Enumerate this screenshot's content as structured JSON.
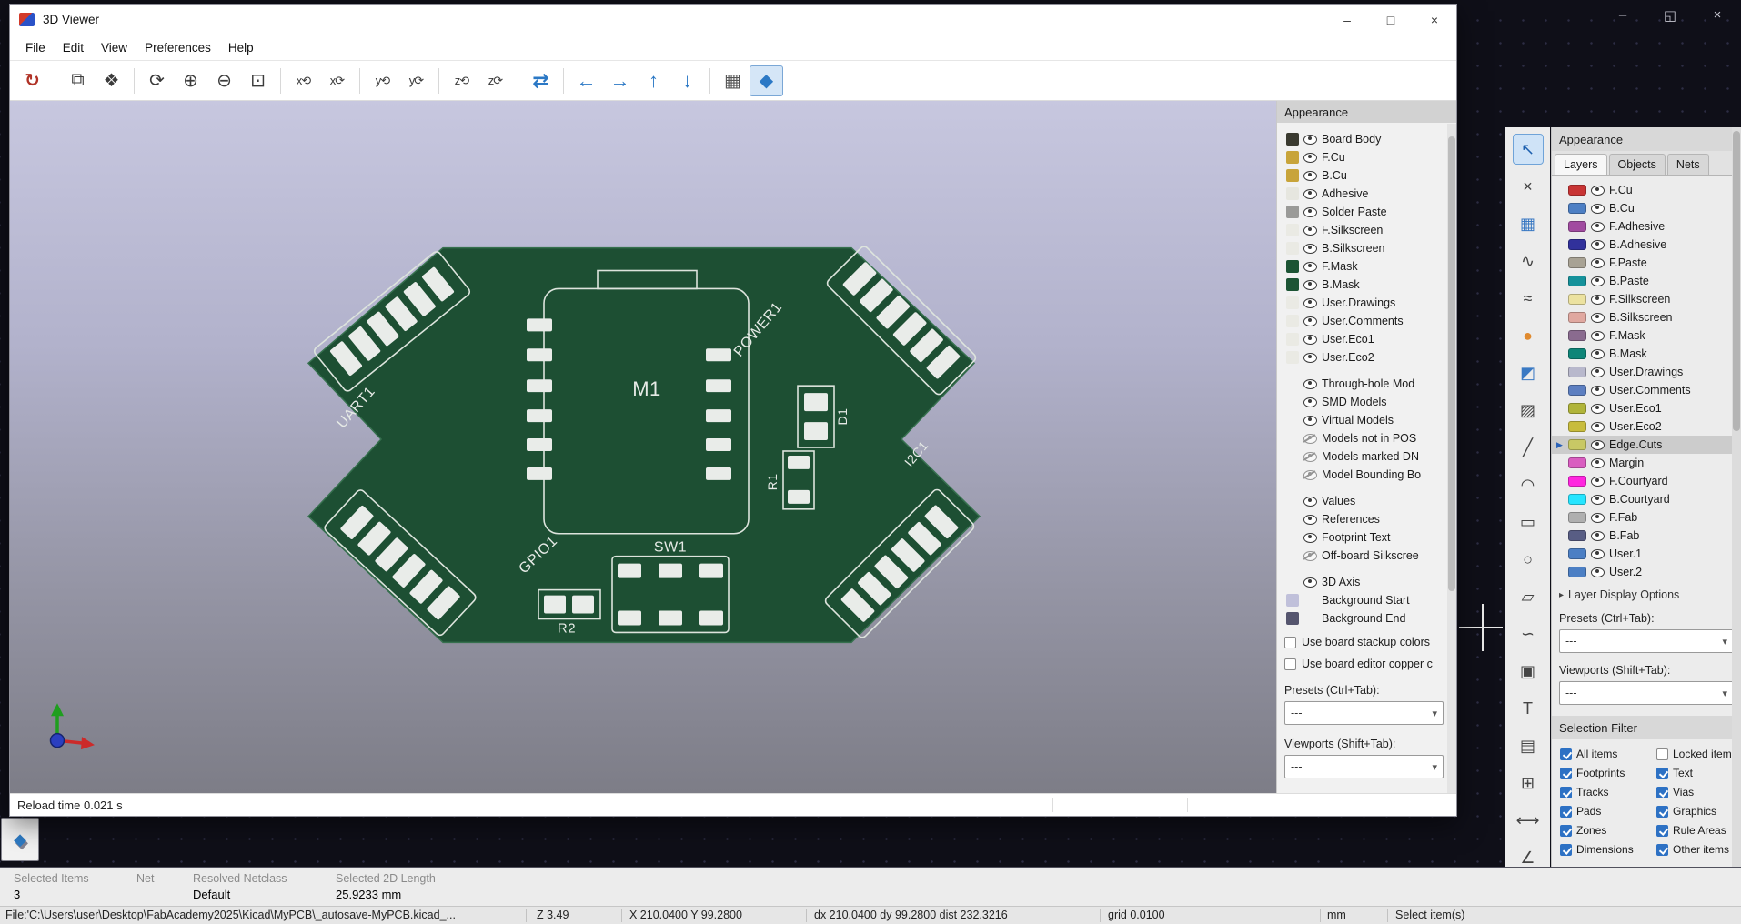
{
  "icons": {
    "dropdown_chevron": "▾",
    "collapse_arrow": "▸"
  },
  "viewer": {
    "title": "3D Viewer",
    "controls": [
      {
        "name": "minimize-button",
        "glyph": "–"
      },
      {
        "name": "maximize-button",
        "glyph": "□"
      },
      {
        "name": "close-button",
        "glyph": "×"
      }
    ],
    "menus": [
      {
        "name": "menu-file",
        "label": "File"
      },
      {
        "name": "menu-edit",
        "label": "Edit"
      },
      {
        "name": "menu-view",
        "label": "View"
      },
      {
        "name": "menu-preferences",
        "label": "Preferences"
      },
      {
        "name": "menu-help",
        "label": "Help"
      }
    ],
    "toolbar": [
      {
        "name": "reload-board-icon",
        "glyph": "↻",
        "cls": "red",
        "ia": "true"
      },
      {
        "name": "toolbar-separator",
        "glyph": "",
        "cls": "sep",
        "ia": "false"
      },
      {
        "name": "copy-image-icon",
        "glyph": "⧉",
        "cls": "",
        "ia": "true"
      },
      {
        "name": "render-raytracing-icon",
        "glyph": "❖",
        "cls": "",
        "ia": "true"
      },
      {
        "name": "toolbar-separator",
        "glyph": "",
        "cls": "sep",
        "ia": "false"
      },
      {
        "name": "redraw-icon",
        "glyph": "⟳",
        "cls": "",
        "ia": "true"
      },
      {
        "name": "zoom-in-icon",
        "glyph": "⊕",
        "cls": "",
        "ia": "true"
      },
      {
        "name": "zoom-out-icon",
        "glyph": "⊖",
        "cls": "",
        "ia": "true"
      },
      {
        "name": "zoom-fit-icon",
        "glyph": "⊡",
        "cls": "",
        "ia": "true"
      },
      {
        "name": "toolbar-separator",
        "glyph": "",
        "cls": "sep",
        "ia": "false"
      },
      {
        "name": "rotate-x-cw-icon",
        "glyph": "x⟲",
        "cls": "axis",
        "ia": "true"
      },
      {
        "name": "rotate-x-ccw-icon",
        "glyph": "x⟳",
        "cls": "axis",
        "ia": "true"
      },
      {
        "name": "toolbar-separator",
        "glyph": "",
        "cls": "sep",
        "ia": "false"
      },
      {
        "name": "rotate-y-cw-icon",
        "glyph": "y⟲",
        "cls": "axis",
        "ia": "true"
      },
      {
        "name": "rotate-y-ccw-icon",
        "glyph": "y⟳",
        "cls": "axis",
        "ia": "true"
      },
      {
        "name": "toolbar-separator",
        "glyph": "",
        "cls": "sep",
        "ia": "false"
      },
      {
        "name": "rotate-z-cw-icon",
        "glyph": "z⟲",
        "cls": "axis",
        "ia": "true"
      },
      {
        "name": "rotate-z-ccw-icon",
        "glyph": "z⟳",
        "cls": "axis",
        "ia": "true"
      },
      {
        "name": "toolbar-separator",
        "glyph": "",
        "cls": "sep",
        "ia": "false"
      },
      {
        "name": "flip-board-icon",
        "glyph": "⇄",
        "cls": "blue",
        "ia": "true"
      },
      {
        "name": "toolbar-separator",
        "glyph": "",
        "cls": "sep",
        "ia": "false"
      },
      {
        "name": "move-left-icon",
        "glyph": "←",
        "cls": "blue",
        "ia": "true"
      },
      {
        "name": "move-right-icon",
        "glyph": "→",
        "cls": "blue",
        "ia": "true"
      },
      {
        "name": "move-up-icon",
        "glyph": "↑",
        "cls": "blue",
        "ia": "true"
      },
      {
        "name": "move-down-icon",
        "glyph": "↓",
        "cls": "blue",
        "ia": "true"
      },
      {
        "name": "toolbar-separator",
        "glyph": "",
        "cls": "sep",
        "ia": "false"
      },
      {
        "name": "orthographic-projection-icon",
        "glyph": "▦",
        "cls": "cube",
        "ia": "true"
      },
      {
        "name": "appearance-manager-icon",
        "glyph": "◆",
        "cls": "blue active",
        "ia": "true"
      }
    ],
    "board": {
      "labels": {
        "m1": "M1",
        "power1": "POWER1",
        "uart1": "UART1",
        "gpio1": "GPIO1",
        "sw1": "SW1",
        "r1": "R1",
        "r2": "R2",
        "d1": "D1",
        "i2c1": "I2C1"
      }
    },
    "panel": {
      "header": "Appearance",
      "rows": [
        {
          "label": "Board Body",
          "swatch": "#3a3a30",
          "eye": "open",
          "cls": ""
        },
        {
          "label": "F.Cu",
          "swatch": "#c8a43a",
          "eye": "open",
          "cls": ""
        },
        {
          "label": "B.Cu",
          "swatch": "#c8a43a",
          "eye": "open",
          "cls": ""
        },
        {
          "label": "Adhesive",
          "swatch": "#e6e6df",
          "eye": "open",
          "cls": ""
        },
        {
          "label": "Solder Paste",
          "swatch": "#9a9a98",
          "eye": "open",
          "cls": ""
        },
        {
          "label": "F.Silkscreen",
          "swatch": "#eaeae4",
          "eye": "open",
          "cls": ""
        },
        {
          "label": "B.Silkscreen",
          "swatch": "#eaeae4",
          "eye": "open",
          "cls": ""
        },
        {
          "label": "F.Mask",
          "swatch": "#1c5434",
          "eye": "open",
          "cls": ""
        },
        {
          "label": "B.Mask",
          "swatch": "#1c5434",
          "eye": "open",
          "cls": ""
        },
        {
          "label": "User.Drawings",
          "swatch": "#eaeae4",
          "eye": "open",
          "cls": ""
        },
        {
          "label": "User.Comments",
          "swatch": "#eaeae4",
          "eye": "open",
          "cls": ""
        },
        {
          "label": "User.Eco1",
          "swatch": "#eaeae4",
          "eye": "open",
          "cls": ""
        },
        {
          "label": "User.Eco2",
          "swatch": "#eaeae4",
          "eye": "open",
          "cls": ""
        },
        {
          "label": "Through-hole Mod",
          "swatch": "",
          "eye": "open",
          "cls": "gap"
        },
        {
          "label": "SMD Models",
          "swatch": "",
          "eye": "open",
          "cls": ""
        },
        {
          "label": "Virtual Models",
          "swatch": "",
          "eye": "open",
          "cls": ""
        },
        {
          "label": "Models not in POS",
          "swatch": "",
          "eye": "crossed",
          "cls": ""
        },
        {
          "label": "Models marked DN",
          "swatch": "",
          "eye": "crossed",
          "cls": ""
        },
        {
          "label": "Model Bounding Bo",
          "swatch": "",
          "eye": "crossed",
          "cls": ""
        },
        {
          "label": "Values",
          "swatch": "",
          "eye": "open",
          "cls": "gap"
        },
        {
          "label": "References",
          "swatch": "",
          "eye": "open",
          "cls": ""
        },
        {
          "label": "Footprint Text",
          "swatch": "",
          "eye": "open",
          "cls": ""
        },
        {
          "label": "Off-board Silkscree",
          "swatch": "",
          "eye": "crossed",
          "cls": ""
        },
        {
          "label": "3D Axis",
          "swatch": "",
          "eye": "open",
          "cls": "gap"
        },
        {
          "label": "Background Start",
          "swatch": "#c0c0da",
          "eye": "none",
          "cls": ""
        },
        {
          "label": "Background End",
          "swatch": "#55556e",
          "eye": "none",
          "cls": ""
        }
      ],
      "checkboxes": [
        {
          "label": "Use board stackup colors",
          "state": "unchecked"
        },
        {
          "label": "Use board editor copper c",
          "state": "unchecked"
        }
      ],
      "presets_label": "Presets (Ctrl+Tab):",
      "presets_value": "---",
      "viewports_label": "Viewports (Shift+Tab):",
      "viewports_value": "---"
    },
    "status": "Reload time 0.021 s"
  },
  "editor": {
    "window_controls": [
      {
        "name": "window-minimize-button",
        "glyph": "–"
      },
      {
        "name": "window-restore-button",
        "glyph": "◱"
      },
      {
        "name": "window-close-button",
        "glyph": "×"
      }
    ],
    "right_toolbar": [
      {
        "name": "select-tool-icon",
        "glyph": "↖",
        "cls": "active"
      },
      {
        "name": "highlight-net-icon",
        "glyph": "×",
        "cls": ""
      },
      {
        "name": "local-ratsnest-icon",
        "glyph": "▦",
        "cls": "blue"
      },
      {
        "name": "route-tracks-icon",
        "glyph": "∿",
        "cls": ""
      },
      {
        "name": "tune-length-icon",
        "glyph": "≈",
        "cls": ""
      },
      {
        "name": "add-via-icon",
        "glyph": "●",
        "cls": "orange"
      },
      {
        "name": "draw-zone-icon",
        "glyph": "◩",
        "cls": "blue"
      },
      {
        "name": "rule-area-icon",
        "glyph": "▨",
        "cls": ""
      },
      {
        "name": "draw-line-icon",
        "glyph": "╱",
        "cls": ""
      },
      {
        "name": "draw-arc-icon",
        "glyph": "◠",
        "cls": ""
      },
      {
        "name": "draw-rectangle-icon",
        "glyph": "▭",
        "cls": ""
      },
      {
        "name": "draw-circle-icon",
        "glyph": "○",
        "cls": ""
      },
      {
        "name": "draw-polygon-icon",
        "glyph": "▱",
        "cls": ""
      },
      {
        "name": "draw-bezier-icon",
        "glyph": "∽",
        "cls": ""
      },
      {
        "name": "add-image-icon",
        "glyph": "▣",
        "cls": ""
      },
      {
        "name": "add-text-icon",
        "glyph": "T",
        "cls": ""
      },
      {
        "name": "add-textbox-icon",
        "glyph": "▤",
        "cls": ""
      },
      {
        "name": "add-table-icon",
        "glyph": "⊞",
        "cls": ""
      },
      {
        "name": "add-dimension-icon",
        "glyph": "⟷",
        "cls": ""
      },
      {
        "name": "measure-tool-icon",
        "glyph": "∠",
        "cls": ""
      }
    ],
    "appearance": {
      "header": "Appearance",
      "tabs": [
        {
          "name": "tab-layers",
          "label": "Layers",
          "cls": "active"
        },
        {
          "name": "tab-objects",
          "label": "Objects",
          "cls": ""
        },
        {
          "name": "tab-nets",
          "label": "Nets",
          "cls": ""
        }
      ],
      "layers": [
        {
          "label": "F.Cu",
          "color": "#c83434",
          "cls": "",
          "marker": ""
        },
        {
          "label": "B.Cu",
          "color": "#4d7fc4",
          "cls": "",
          "marker": ""
        },
        {
          "label": "F.Adhesive",
          "color": "#a14ba0",
          "cls": "",
          "marker": ""
        },
        {
          "label": "B.Adhesive",
          "color": "#31319b",
          "cls": "",
          "marker": ""
        },
        {
          "label": "F.Paste",
          "color": "#a8a294",
          "cls": "",
          "marker": ""
        },
        {
          "label": "B.Paste",
          "color": "#16929b",
          "cls": "",
          "marker": ""
        },
        {
          "label": "F.Silkscreen",
          "color": "#ece2a0",
          "cls": "",
          "marker": ""
        },
        {
          "label": "B.Silkscreen",
          "color": "#e0a8a0",
          "cls": "",
          "marker": ""
        },
        {
          "label": "F.Mask",
          "color": "#8a6b8f",
          "cls": "",
          "marker": ""
        },
        {
          "label": "B.Mask",
          "color": "#0e8578",
          "cls": "",
          "marker": ""
        },
        {
          "label": "User.Drawings",
          "color": "#b8b8cc",
          "cls": "",
          "marker": ""
        },
        {
          "label": "User.Comments",
          "color": "#5d7fc1",
          "cls": "",
          "marker": ""
        },
        {
          "label": "User.Eco1",
          "color": "#b0b43a",
          "cls": "",
          "marker": ""
        },
        {
          "label": "User.Eco2",
          "color": "#c8bc3c",
          "cls": "",
          "marker": ""
        },
        {
          "label": "Edge.Cuts",
          "color": "#c8c865",
          "cls": "selected",
          "marker": "▶"
        },
        {
          "label": "Margin",
          "color": "#d95dc0",
          "cls": "",
          "marker": ""
        },
        {
          "label": "F.Courtyard",
          "color": "#ff26df",
          "cls": "",
          "marker": ""
        },
        {
          "label": "B.Courtyard",
          "color": "#26e5ff",
          "cls": "",
          "marker": ""
        },
        {
          "label": "F.Fab",
          "color": "#afafaf",
          "cls": "",
          "marker": ""
        },
        {
          "label": "B.Fab",
          "color": "#585d84",
          "cls": "",
          "marker": ""
        },
        {
          "label": "User.1",
          "color": "#4c7fc4",
          "cls": "",
          "marker": ""
        },
        {
          "label": "User.2",
          "color": "#4c7fc4",
          "cls": "",
          "marker": ""
        }
      ],
      "layer_display_options": "Layer Display Options",
      "presets_label": "Presets (Ctrl+Tab):",
      "presets_value": "---",
      "viewports_label": "Viewports (Shift+Tab):",
      "viewports_value": "---"
    },
    "selection_filter": {
      "header": "Selection Filter",
      "items": [
        {
          "label": "All items",
          "state": "checked"
        },
        {
          "label": "Locked items",
          "state": "unchecked"
        },
        {
          "label": "Footprints",
          "state": "checked"
        },
        {
          "label": "Text",
          "state": "checked"
        },
        {
          "label": "Tracks",
          "state": "checked"
        },
        {
          "label": "Vias",
          "state": "checked"
        },
        {
          "label": "Pads",
          "state": "checked"
        },
        {
          "label": "Graphics",
          "state": "checked"
        },
        {
          "label": "Zones",
          "state": "checked"
        },
        {
          "label": "Rule Areas",
          "state": "checked"
        },
        {
          "label": "Dimensions",
          "state": "checked"
        },
        {
          "label": "Other items",
          "state": "checked"
        }
      ]
    },
    "message_panel": {
      "selected_items_label": "Selected Items",
      "selected_items_value": "3",
      "net_label": "Net",
      "netclass_label": "Resolved Netclass",
      "netclass_value": "Default",
      "length_label": "Selected 2D Length",
      "length_value": "25.9233 mm"
    },
    "status_bar": {
      "file": "File:'C:\\Users\\user\\Desktop\\FabAcademy2025\\Kicad\\MyPCB\\_autosave-MyPCB.kicad_...",
      "z": "Z 3.49",
      "xy": "X 210.0400  Y 99.2800",
      "d": "dx 210.0400  dy 99.2800  dist 232.3216",
      "grid": "grid 0.0100",
      "units": "mm",
      "hint": "Select item(s)"
    }
  }
}
